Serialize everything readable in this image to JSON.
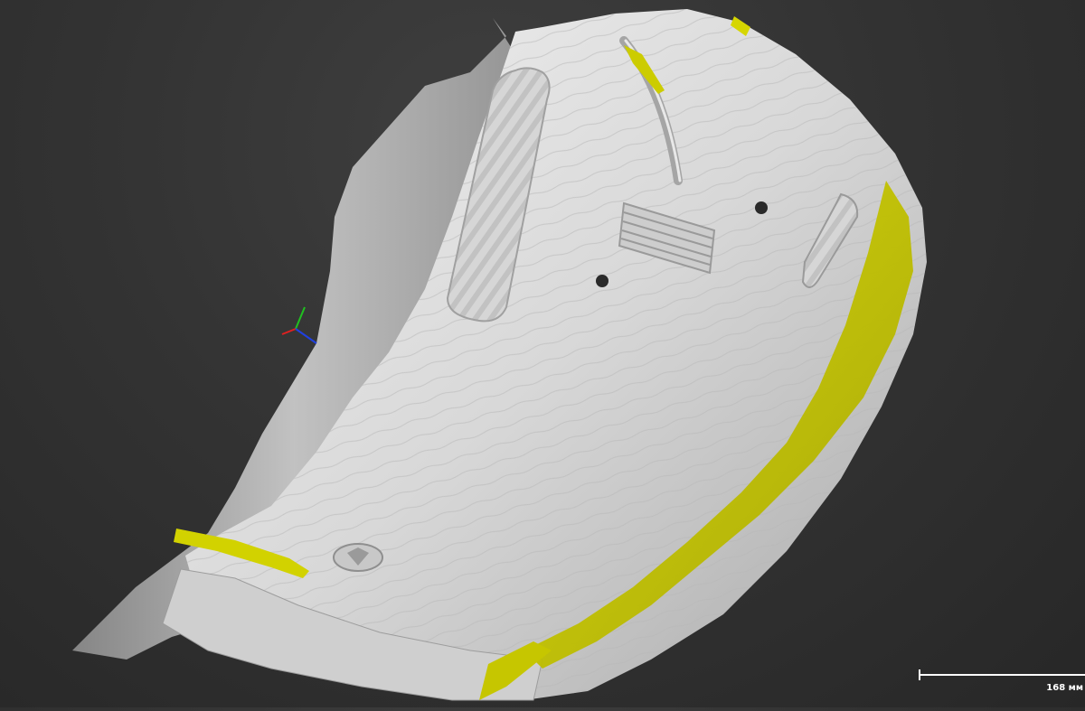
{
  "viewer": {
    "scale_label": "168 мм",
    "background_color": "#333333",
    "model_color": "#dcdcdc",
    "deviation_color": "#c8c800"
  },
  "axis_gizmo": {
    "x_color": "#e02020",
    "y_color": "#20c020",
    "z_color": "#2040e0"
  }
}
